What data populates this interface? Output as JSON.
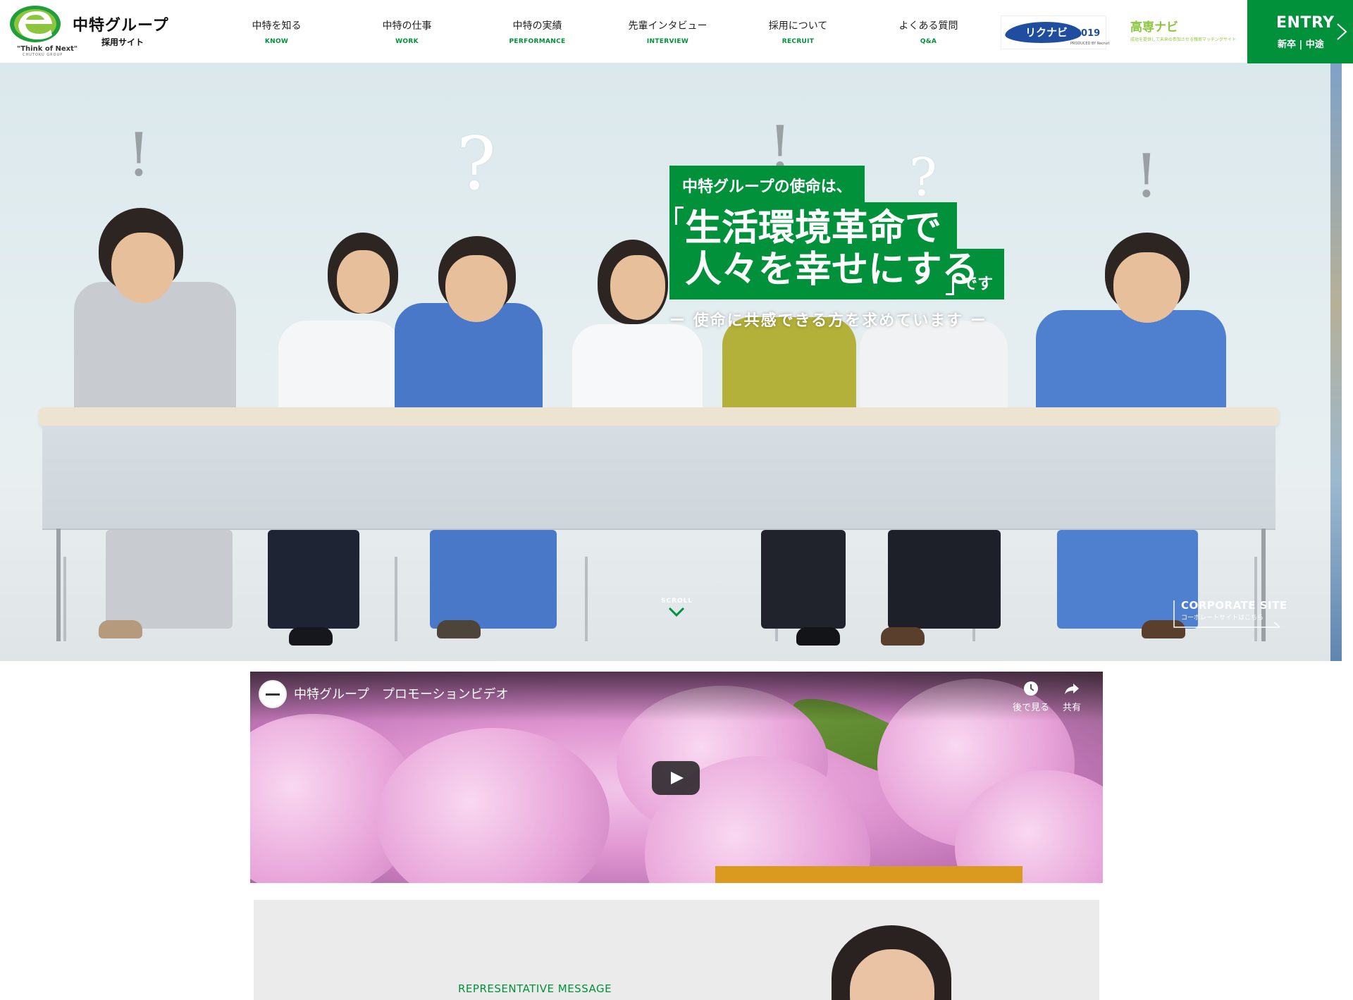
{
  "header": {
    "logo": {
      "name": "中特グループ",
      "site": "採用サイト",
      "tagline": "\"Think of Next\"",
      "tagline_sub": "CHUTOKU GROUP"
    },
    "nav": [
      {
        "ja": "中特を知る",
        "en": "KNOW"
      },
      {
        "ja": "中特の仕事",
        "en": "WORK"
      },
      {
        "ja": "中特の実績",
        "en": "PERFORMANCE"
      },
      {
        "ja": "先輩インタビュー",
        "en": "INTERVIEW"
      },
      {
        "ja": "採用について",
        "en": "RECRUIT"
      },
      {
        "ja": "よくある質問",
        "en": "Q&A"
      }
    ],
    "rikunabi": {
      "label": "リクナビ",
      "year": "2019",
      "small": "PRODUCED BY Recruit"
    },
    "kosen": {
      "title": "高専ナビ",
      "sub": "成功を提供して未来の参加させる親密マッチングサイト"
    },
    "entry": {
      "title": "ENTRY",
      "sub": "新卒 | 中途"
    }
  },
  "hero": {
    "intro": "中特グループの使命は、",
    "main_line1": "生活環境革命で",
    "main_line2": "人々を幸せにする",
    "suffix": "です",
    "sub": "ー 使命に共感できる方を求めています ー",
    "scroll": "SCROLL",
    "corporate": {
      "title": "CORPORATE SITE",
      "sub": "コーポレートサイトはこちら"
    },
    "slides": 3,
    "active_slide": 1,
    "marks": [
      "!",
      "?",
      "!",
      "?",
      "!"
    ]
  },
  "video": {
    "title": "中特グループ　プロモーションビデオ",
    "watch_later": "後で見る",
    "share": "共有"
  },
  "message": {
    "label": "REPRESENTATIVE MESSAGE"
  },
  "colors": {
    "brand_green": "#00913a",
    "kosen_green": "#8cc63f",
    "rikunabi_blue": "#1f4ea1",
    "dot_active": "#3b6fd6"
  }
}
